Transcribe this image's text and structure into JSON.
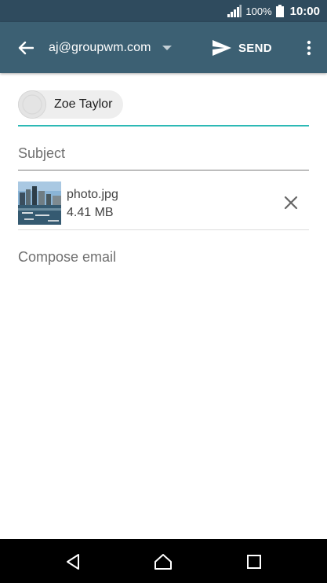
{
  "status_bar": {
    "battery_percent": "100%",
    "time": "10:00",
    "icons": [
      "signal-icon",
      "battery-icon"
    ]
  },
  "app_bar": {
    "account": "aj@groupwm.com",
    "send_label": "SEND",
    "icons": [
      "back-arrow-icon",
      "dropdown-caret-icon",
      "send-icon",
      "more-vert-icon"
    ],
    "color": "#3c6073"
  },
  "recipients": [
    {
      "name": "Zoe Taylor"
    }
  ],
  "subject": {
    "placeholder": "Subject",
    "value": ""
  },
  "attachment": {
    "file_name": "photo.jpg",
    "file_size": "4.41 MB"
  },
  "body": {
    "placeholder": "Compose email",
    "value": ""
  },
  "navigation": {
    "icons": [
      "back-triangle-icon",
      "home-icon",
      "recents-icon"
    ]
  },
  "accent_color": "#2cb9b5"
}
